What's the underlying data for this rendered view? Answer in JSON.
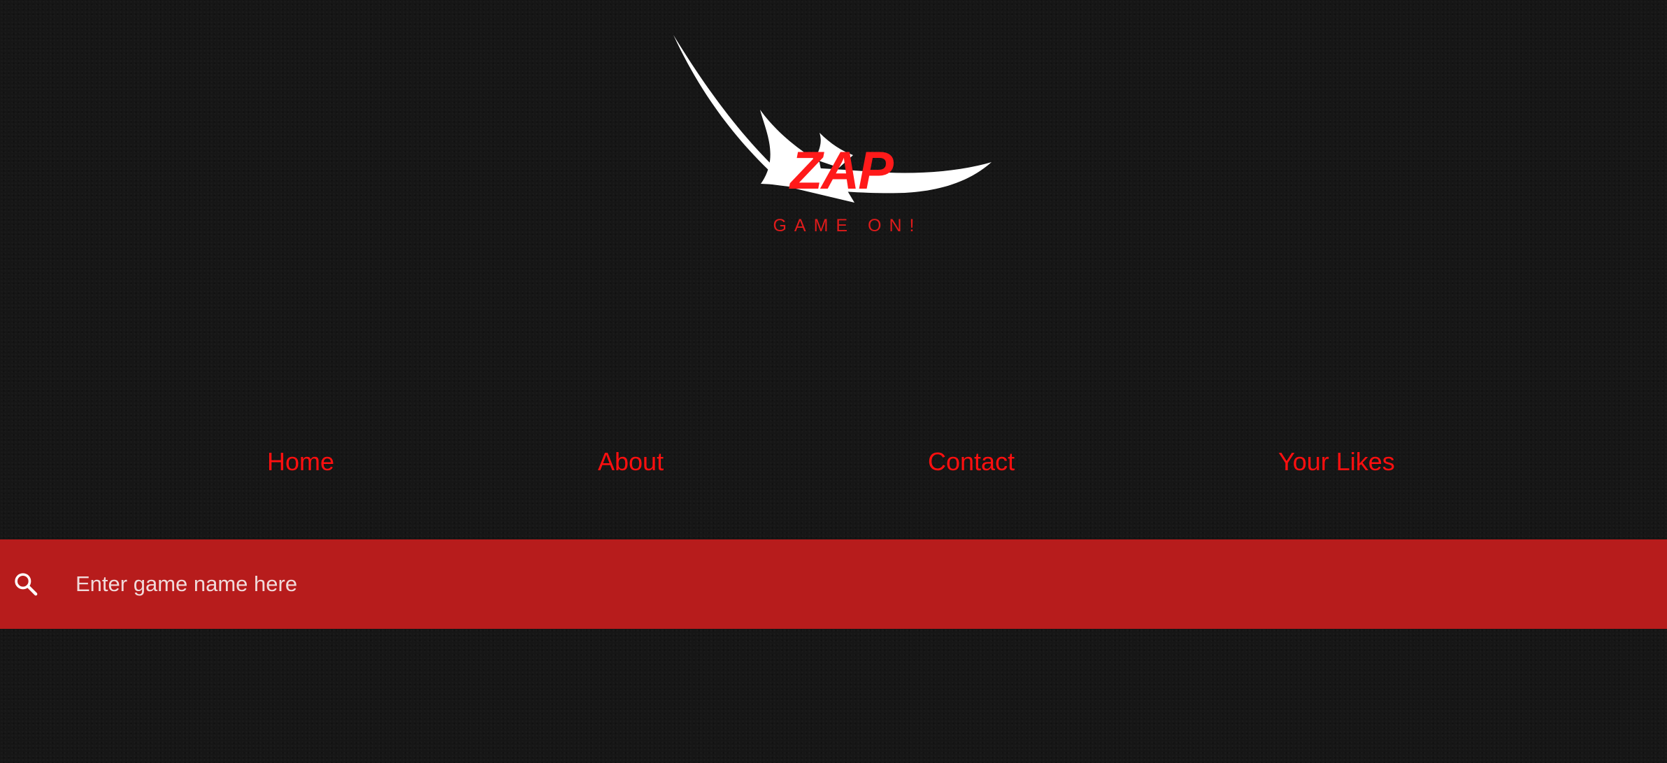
{
  "brand": {
    "wordmark": "ZAP",
    "tagline": "GAME ON!",
    "wordmark_color": "#ff1a1a",
    "swoosh_color": "#ffffff"
  },
  "nav": {
    "items": [
      {
        "label": "Home"
      },
      {
        "label": "About"
      },
      {
        "label": "Contact"
      },
      {
        "label": "Your Likes"
      }
    ],
    "link_color": "#ff0f0f"
  },
  "search": {
    "icon": "search-icon",
    "placeholder": "Enter game name here",
    "value": "",
    "bar_color": "#b71c1c"
  },
  "theme": {
    "background": "#161616"
  }
}
